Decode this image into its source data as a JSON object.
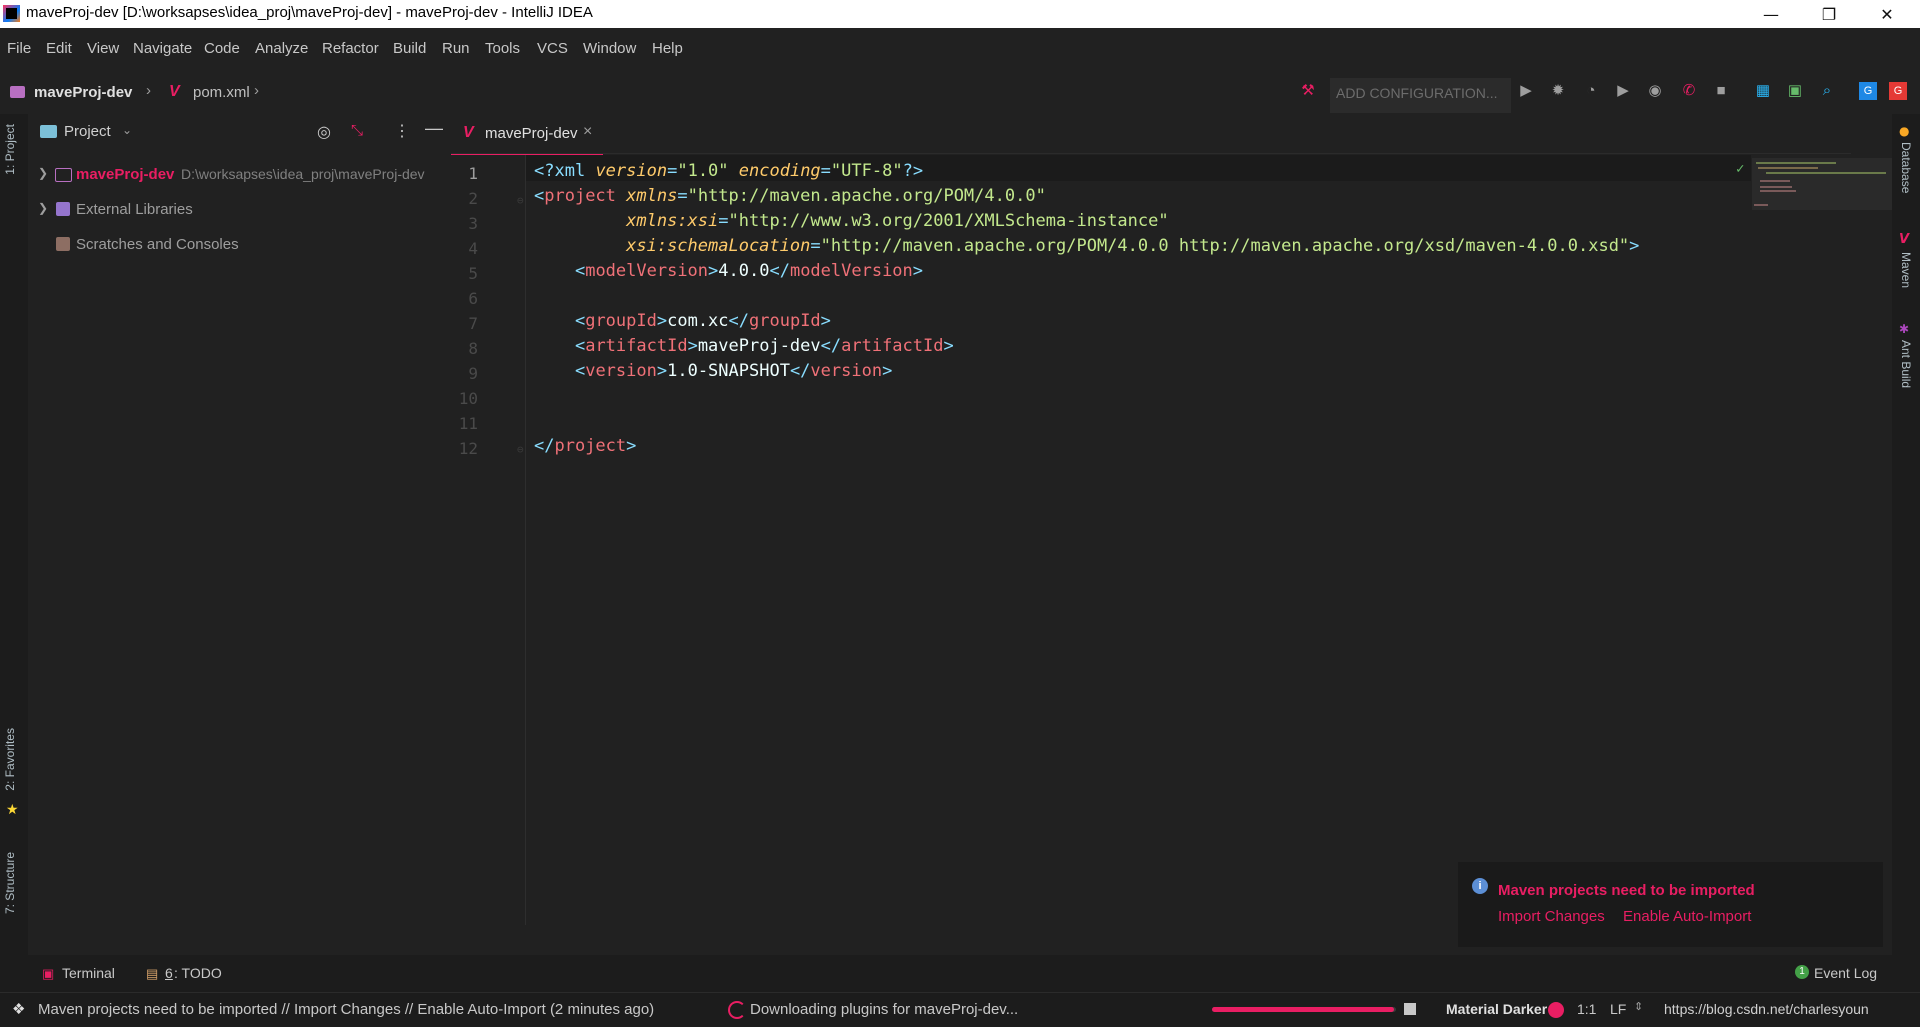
{
  "window": {
    "title": "maveProj-dev [D:\\worksapses\\idea_proj\\maveProj-dev] - maveProj-dev - IntelliJ IDEA",
    "minimize": "—",
    "restore": "❐",
    "close": "✕"
  },
  "menu": [
    "File",
    "Edit",
    "View",
    "Navigate",
    "Code",
    "Analyze",
    "Refactor",
    "Build",
    "Run",
    "Tools",
    "VCS",
    "Window",
    "Help"
  ],
  "breadcrumb": {
    "project": "maveProj-dev",
    "file": "pom.xml",
    "sep": "›"
  },
  "toolbar": {
    "run_config_placeholder": "ADD CONFIGURATION..."
  },
  "left_stripe": {
    "project": "1: Project",
    "favorites": "2: Favorites",
    "structure": "7: Structure"
  },
  "right_stripe": {
    "database": "Database",
    "maven": "Maven",
    "ant": "Ant Build"
  },
  "project_panel": {
    "title": "Project",
    "tree": [
      {
        "name": "maveProj-dev",
        "path": "D:\\worksapses\\idea_proj\\maveProj-dev"
      },
      {
        "name": "External Libraries"
      },
      {
        "name": "Scratches and Consoles"
      }
    ]
  },
  "editor": {
    "tab": "maveProj-dev",
    "tab_close": "×",
    "line_numbers": [
      "1",
      "2",
      "3",
      "4",
      "5",
      "6",
      "7",
      "8",
      "9",
      "10",
      "11",
      "12"
    ],
    "code": {
      "l1_decl": "<?xml",
      "l1_a1": "version",
      "l1_v1": "\"1.0\"",
      "l1_a2": "encoding",
      "l1_v2": "\"UTF-8\"",
      "l1_end": "?>",
      "l2_tag": "project",
      "l2_attr": "xmlns",
      "l2_val": "\"http://maven.apache.org/POM/4.0.0\"",
      "l3_attr": "xmlns:xsi",
      "l3_val": "\"http://www.w3.org/2001/XMLSchema-instance\"",
      "l4_attr": "xsi:schemaLocation",
      "l4_val": "\"http://maven.apache.org/POM/4.0.0 http://maven.apache.org/xsd/maven-4.0.0.xsd\"",
      "l5_tag": "modelVersion",
      "l5_text": "4.0.0",
      "l7_tag": "groupId",
      "l7_text": "com.xc",
      "l8_tag": "artifactId",
      "l8_text": "maveProj-dev",
      "l9_tag": "version",
      "l9_text": "1.0-SNAPSHOT",
      "l12_tag": "project"
    }
  },
  "notification": {
    "title": "Maven projects need to be imported",
    "action_import": "Import Changes",
    "action_auto": "Enable Auto-Import"
  },
  "bottom_tools": {
    "terminal": "Terminal",
    "todo_num": "6",
    "todo": ": TODO",
    "event_log": "Event Log"
  },
  "status": {
    "message": "Maven projects need to be imported // Import Changes // Enable Auto-Import (2 minutes ago)",
    "progress": "Downloading plugins for maveProj-dev...",
    "progress_fraction": 0.99,
    "theme": "Material Darker",
    "position": "1:1",
    "line_sep": "LF",
    "watermark": "https://blog.csdn.net/charlesyoun"
  },
  "colors": {
    "accent": "#e91e63",
    "bg": "#212121",
    "tag": "#f07178",
    "attr": "#ffcb6b",
    "string": "#c3e88d",
    "bracket": "#89ddff"
  }
}
